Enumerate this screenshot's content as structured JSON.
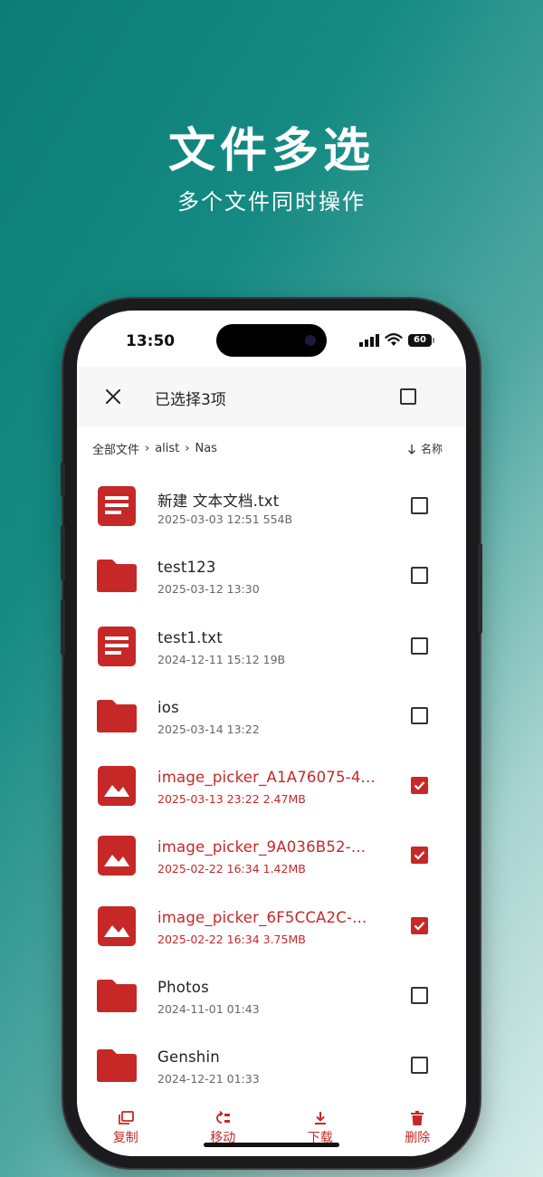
{
  "hero": {
    "title": "文件多选",
    "subtitle": "多个文件同时操作"
  },
  "status_bar": {
    "time": "13:50",
    "battery": "60"
  },
  "app_bar": {
    "title": "已选择3项"
  },
  "breadcrumb": [
    "全部文件",
    "alist",
    "Nas"
  ],
  "sort": {
    "label": "名称",
    "icon": "arrow-down-icon"
  },
  "files": [
    {
      "name": "新建 文本文档.txt",
      "meta": "2025-03-03 12:51  554B",
      "type": "document",
      "selected": false
    },
    {
      "name": "test123",
      "meta": "2025-03-12 13:30",
      "type": "folder",
      "selected": false
    },
    {
      "name": "test1.txt",
      "meta": "2024-12-11 15:12  19B",
      "type": "document",
      "selected": false
    },
    {
      "name": "ios",
      "meta": "2025-03-14 13:22",
      "type": "folder",
      "selected": false
    },
    {
      "name": "image_picker_A1A76075-4...",
      "meta": "2025-03-13 23:22  2.47MB",
      "type": "image",
      "selected": true
    },
    {
      "name": "image_picker_9A036B52-...",
      "meta": "2025-02-22 16:34  1.42MB",
      "type": "image",
      "selected": true
    },
    {
      "name": "image_picker_6F5CCA2C-...",
      "meta": "2025-02-22 16:34  3.75MB",
      "type": "image",
      "selected": true
    },
    {
      "name": "Photos",
      "meta": "2024-11-01 01:43",
      "type": "folder",
      "selected": false
    },
    {
      "name": "Genshin",
      "meta": "2024-12-21 01:33",
      "type": "folder",
      "selected": false
    }
  ],
  "actions": [
    {
      "label": "复制",
      "icon": "copy-icon"
    },
    {
      "label": "移动",
      "icon": "move-icon"
    },
    {
      "label": "下载",
      "icon": "download-icon"
    },
    {
      "label": "删除",
      "icon": "delete-icon"
    }
  ],
  "colors": {
    "accent": "#c62828",
    "background_start": "#0d7e76",
    "background_end": "#d6ece9"
  }
}
